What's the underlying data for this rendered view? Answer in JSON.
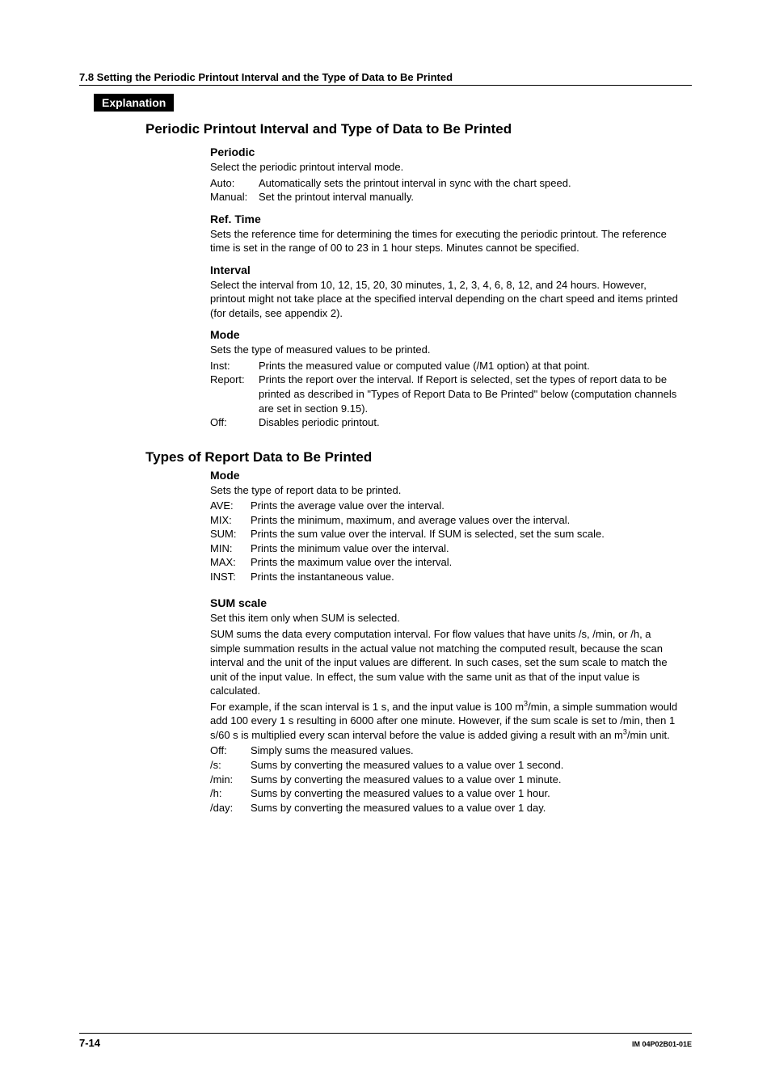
{
  "header": {
    "section": "7.8  Setting the Periodic Printout Interval and the Type of Data to Be Printed"
  },
  "explanation_label": "Explanation",
  "section1": {
    "title": "Periodic Printout Interval and Type of Data to Be Printed",
    "periodic": {
      "heading": "Periodic",
      "intro": "Select the periodic printout interval mode.",
      "items": [
        {
          "term": "Auto:",
          "desc": "Automatically sets the printout interval in sync with the chart speed."
        },
        {
          "term": "Manual:",
          "desc": "Set the printout interval manually."
        }
      ]
    },
    "reftime": {
      "heading": "Ref. Time",
      "body": "Sets the reference time for determining the times for executing the periodic printout. The reference time is set in the range of 00 to 23 in 1 hour steps. Minutes cannot be specified."
    },
    "interval": {
      "heading": "Interval",
      "body": "Select the interval from 10, 12, 15, 20, 30 minutes, 1, 2, 3, 4, 6, 8, 12, and 24 hours. However, printout might not take place at the specified interval depending on the chart speed and items printed (for details, see appendix 2)."
    },
    "mode": {
      "heading": "Mode",
      "intro": "Sets the type of measured values to be printed.",
      "items": [
        {
          "term": "Inst:",
          "desc": "Prints the measured value or computed value (/M1 option) at that point."
        },
        {
          "term": "Report:",
          "desc": "Prints the report over the interval. If Report is selected, set the types of report data to be printed as described in \"Types of Report Data to Be Printed\" below (computation channels are set in section 9.15)."
        },
        {
          "term": "Off:",
          "desc": "Disables periodic printout."
        }
      ]
    }
  },
  "section2": {
    "title": "Types of Report Data to Be Printed",
    "mode": {
      "heading": "Mode",
      "intro": "Sets the type of report data to be printed.",
      "items": [
        {
          "term": "AVE:",
          "desc": "Prints the average value over the interval."
        },
        {
          "term": "MIX:",
          "desc": "Prints the minimum, maximum, and average values over the interval."
        },
        {
          "term": "SUM:",
          "desc": "Prints the sum value over the interval. If SUM is selected, set the sum scale."
        },
        {
          "term": "MIN:",
          "desc": "Prints the minimum value over the interval."
        },
        {
          "term": "MAX:",
          "desc": "Prints the maximum value over the interval."
        },
        {
          "term": "INST:",
          "desc": "Prints the instantaneous value."
        }
      ]
    },
    "sumscale": {
      "heading": "SUM scale",
      "intro": "Set this item only when SUM is selected.",
      "body1": "SUM sums the data every computation interval. For flow values that have units /s, /min, or /h, a simple summation results in the actual value not matching the computed result, because the scan interval and the unit of the input values are different. In such cases, set the sum scale to match the unit of the input value. In effect, the sum value with the same unit as that of the input value is calculated.",
      "body2_a": "For example, if the scan interval is 1 s, and the input value is 100 m",
      "body2_b": "/min, a simple summation would add 100 every 1 s resulting in 6000 after one minute. However, if the sum scale is set to /min, then 1 s/60 s is multiplied every scan interval before the value is added giving a result with an m",
      "body2_c": "/min unit.",
      "items": [
        {
          "term": "Off:",
          "desc": "Simply sums the measured values."
        },
        {
          "term": "/s:",
          "desc": "Sums by converting the measured values to a value over 1 second."
        },
        {
          "term": "/min:",
          "desc": "Sums by converting the measured values to a value over 1 minute."
        },
        {
          "term": "/h:",
          "desc": "Sums by converting the measured values to a value over 1 hour."
        },
        {
          "term": "/day:",
          "desc": "Sums by converting the measured values to a value over 1 day."
        }
      ]
    }
  },
  "footer": {
    "page": "7-14",
    "docnum": "IM 04P02B01-01E"
  }
}
